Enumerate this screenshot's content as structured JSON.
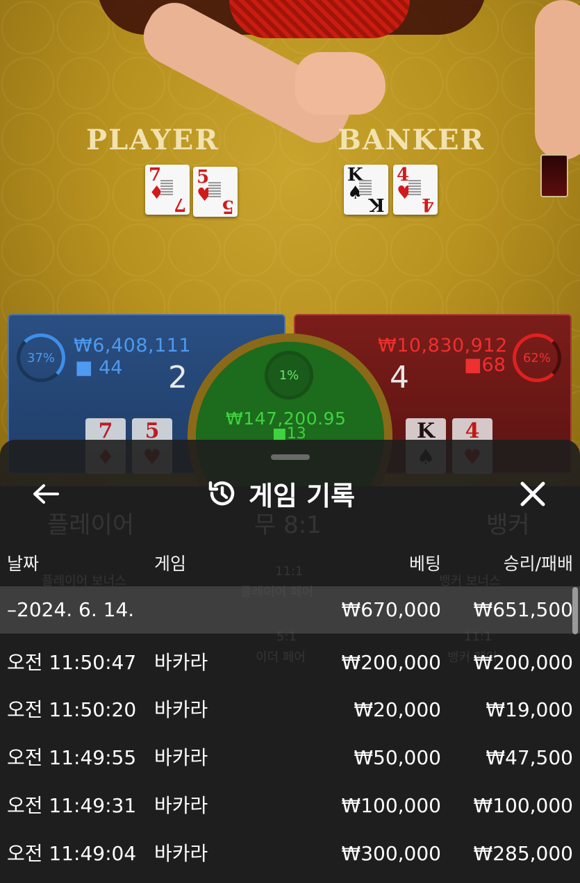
{
  "table": {
    "player_label": "PLAYER",
    "banker_label": "BANKER",
    "player_cards": [
      {
        "rank": "7",
        "suit": "♦",
        "color": "red"
      },
      {
        "rank": "5",
        "suit": "♥",
        "color": "red"
      }
    ],
    "banker_cards": [
      {
        "rank": "K",
        "suit": "♠",
        "color": "black"
      },
      {
        "rank": "4",
        "suit": "♥",
        "color": "red"
      }
    ]
  },
  "player_spot": {
    "percent": "37%",
    "amount": "₩6,408,111",
    "players": "44",
    "score": "2",
    "cards": [
      {
        "rank": "7",
        "suit": "♦"
      },
      {
        "rank": "5",
        "suit": "♥"
      }
    ],
    "color": "#4d9af0"
  },
  "banker_spot": {
    "percent": "62%",
    "amount": "₩10,830,912",
    "players": "68",
    "score": "4",
    "cards": [
      {
        "rank": "K",
        "suit": "♠"
      },
      {
        "rank": "4",
        "suit": "♥"
      }
    ],
    "color": "#ee3030"
  },
  "tie_spot": {
    "percent": "1%",
    "amount": "₩147,200.95",
    "players": "13",
    "color": "#3fd43f"
  },
  "background_labels": {
    "player": "플레이어",
    "tie": "무 8:1",
    "banker": "뱅커",
    "player_bonus": "플레이어 보너스",
    "player_pair_odds": "11:1",
    "player_pair": "플레이어 페어",
    "banker_bonus": "뱅커 보너스",
    "either_pair_odds": "5:1",
    "either_pair": "이더 페어",
    "banker_pair_odds": "11:1",
    "banker_pair": "뱅커 페어"
  },
  "history": {
    "title": "게임 기록",
    "back_icon": "arrow-left-icon",
    "history_icon": "history-icon",
    "close_icon": "close-icon",
    "columns": {
      "date": "날짜",
      "game": "게임",
      "bet": "베팅",
      "result": "승리/패배"
    },
    "date_group": {
      "date": "–2024. 6. 14.",
      "bet": "₩670,000",
      "result": "₩651,500"
    },
    "rows": [
      {
        "time": "오전 11:50:47",
        "game": "바카라",
        "bet": "₩200,000",
        "result": "₩200,000"
      },
      {
        "time": "오전 11:50:20",
        "game": "바카라",
        "bet": "₩20,000",
        "result": "₩19,000"
      },
      {
        "time": "오전 11:49:55",
        "game": "바카라",
        "bet": "₩50,000",
        "result": "₩47,500"
      },
      {
        "time": "오전 11:49:31",
        "game": "바카라",
        "bet": "₩100,000",
        "result": "₩100,000"
      },
      {
        "time": "오전 11:49:04",
        "game": "바카라",
        "bet": "₩300,000",
        "result": "₩285,000"
      }
    ]
  }
}
